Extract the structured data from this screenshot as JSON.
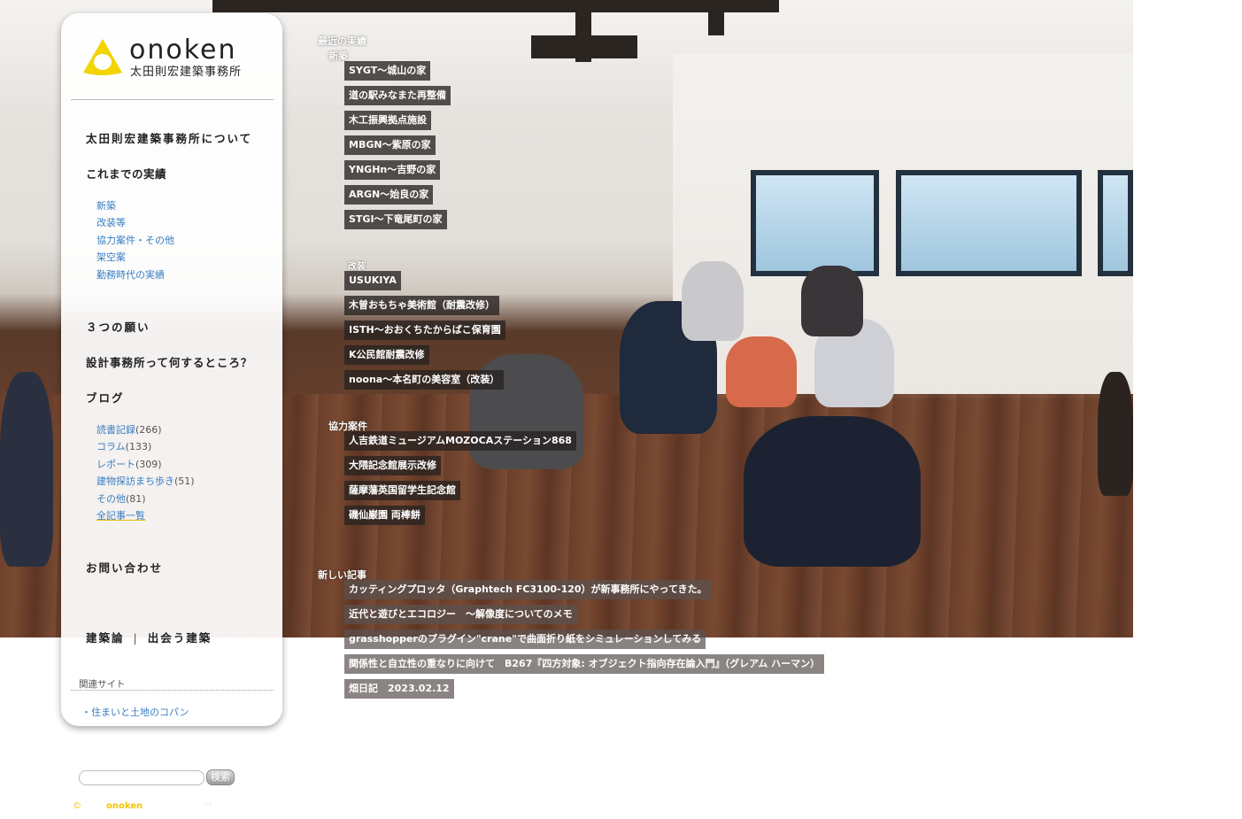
{
  "logo": {
    "wordmark": "onoken",
    "subtitle": "太田則宏建築事務所"
  },
  "nav": {
    "about": "太田則宏建築事務所について",
    "works": "これまでの実績",
    "works_sub": [
      "新築",
      "改装等",
      "協力案件・その他",
      "架空案",
      "勤務時代の実績"
    ],
    "wishes": "３つの願い",
    "what_is": "設計事務所って何するところ？",
    "blog": "ブログ",
    "blog_sub": [
      {
        "label": "読書記録",
        "count": "(266)"
      },
      {
        "label": "コラム",
        "count": "(133)"
      },
      {
        "label": "レポート",
        "count": "(309)"
      },
      {
        "label": "建物探訪まち歩き",
        "count": "(51)"
      },
      {
        "label": "その他",
        "count": "(81)"
      }
    ],
    "all_posts": "全記事一覧",
    "contact": "お問い合わせ",
    "theory": "建築論",
    "meet": "出会う建築"
  },
  "related": {
    "title": "関連サイト",
    "link": "・住まいと土地のコパン"
  },
  "search": {
    "placeholder": "",
    "button": "検索"
  },
  "footer": {
    "copy": "©",
    "brand": "onoken",
    "mark": "ᐟᐟ"
  },
  "overlay": {
    "recent_works": "最近の実績",
    "new_build": "新築",
    "new_build_items": [
      "SYGT～城山の家",
      "道の駅みなまた再整備",
      "木工振興拠点施設",
      "MBGN～紫原の家",
      "YNGHn～吉野の家",
      "ARGN～始良の家",
      "STGI～下竜尾町の家"
    ],
    "renovation": "改装",
    "renovation_items": [
      "USUKIYA",
      "木曽おもちゃ美術館（耐震改修）",
      "ISTH～おおくちたからばこ保育園",
      "K公民館耐震改修",
      "noona～本名町の美容室（改装）"
    ],
    "cooperation": "協力案件",
    "cooperation_items": [
      "人吉鉄道ミュージアムMOZOCAステーション868",
      "大隈記念館展示改修",
      "薩摩藩英国留学生記念館",
      "磯仙巌園 両棒餅"
    ],
    "new_posts": "新しい記事",
    "new_posts_items": [
      "カッティングプロッタ（Graphtech FC3100-120）が新事務所にやってきた。",
      "近代と遊びとエコロジー　～解像度についてのメモ",
      "grasshopperのプラグイン\"crane\"で曲面折り紙をシミュレーションしてみる",
      "関係性と自立性の重なりに向けて　B267『四方対象: オブジェクト指向存在論入門』（グレアム ハーマン）",
      "畑日記　2023.02.12"
    ]
  }
}
